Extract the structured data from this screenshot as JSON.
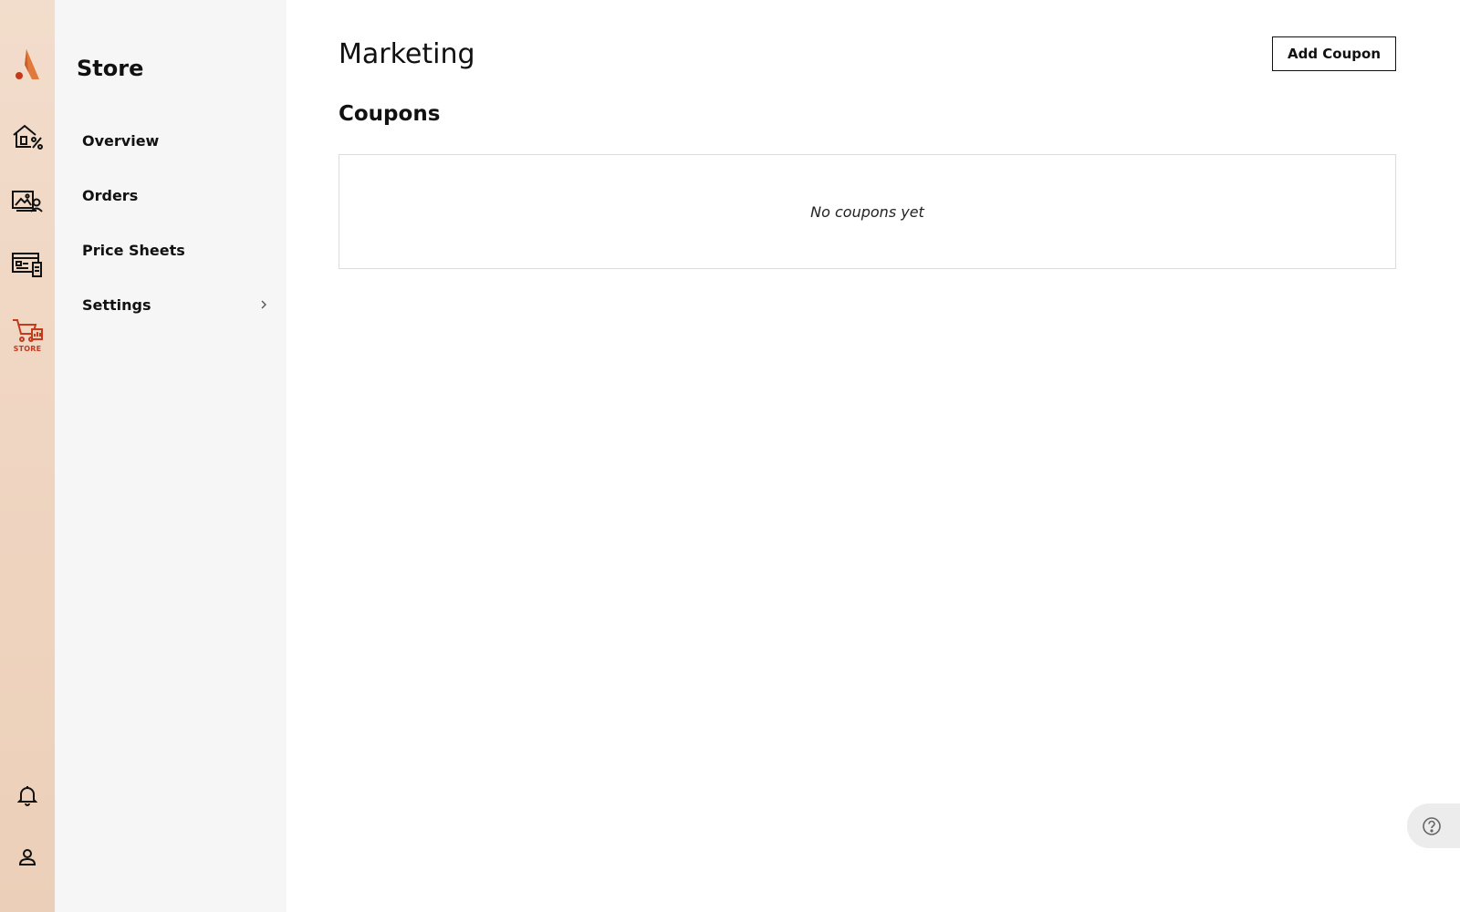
{
  "rail": {
    "logo_icon": "brand-logo",
    "items": [
      {
        "name": "home-sale-icon"
      },
      {
        "name": "gallery-client-icon"
      },
      {
        "name": "website-icon"
      },
      {
        "name": "store-cart-icon",
        "caption": "STORE",
        "active": true
      }
    ],
    "bottom": [
      {
        "name": "bell-icon"
      },
      {
        "name": "account-icon"
      }
    ]
  },
  "sidebar": {
    "title": "Store",
    "items": [
      {
        "label": "Overview"
      },
      {
        "label": "Orders"
      },
      {
        "label": "Price Sheets"
      },
      {
        "label": "Settings",
        "has_submenu": true
      }
    ]
  },
  "main": {
    "title": "Marketing",
    "add_button_label": "Add Coupon",
    "section_title": "Coupons",
    "empty_message": "No coupons yet"
  },
  "colors": {
    "accent": "#c33a1d",
    "logo": "#e07a3c",
    "rail_bg": "#eccfb8",
    "sidebar_bg": "#f6f6f6"
  }
}
